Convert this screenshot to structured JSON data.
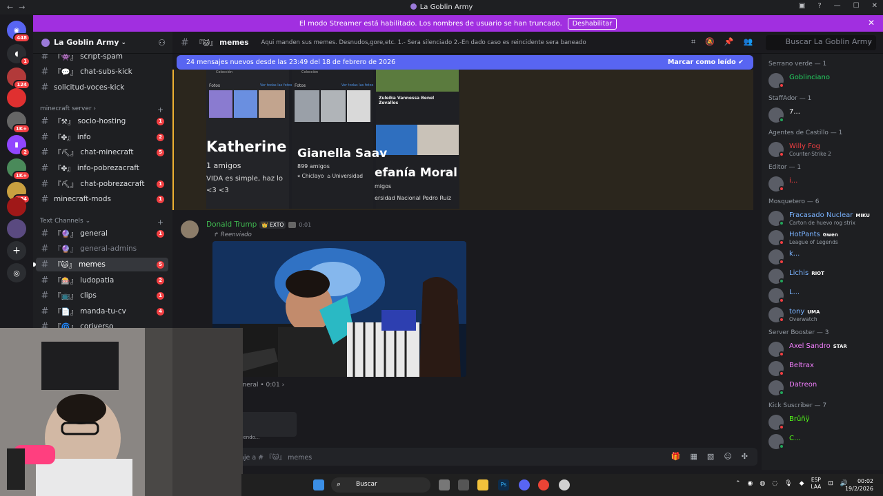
{
  "window": {
    "title": "La Goblin Army"
  },
  "banner": {
    "text": "El modo Streamer está habilitado. Los nombres de usuario se han truncado.",
    "button": "Deshabilitar"
  },
  "guilds": [
    {
      "badge": "448"
    },
    {
      "badge": "1"
    },
    {
      "badge": "124"
    },
    {
      "badge": ""
    },
    {
      "badge": "1K+"
    },
    {
      "badge": "2"
    },
    {
      "badge": "1K+"
    },
    {
      "badge": "104"
    },
    {
      "badge": ""
    },
    {
      "badge": ""
    }
  ],
  "server": {
    "name": "La Goblin Army"
  },
  "channels": {
    "top": [
      {
        "name": "script-spam",
        "prefix": "『👾』"
      },
      {
        "name": "chat-subs-kick",
        "prefix": "『💬』"
      },
      {
        "name": "solicitud-voces-kick",
        "prefix": ""
      }
    ],
    "cat_minecraft": "minecraft server",
    "minecraft": [
      {
        "name": "socio-hosting",
        "prefix": "『⚒』",
        "unread": "1"
      },
      {
        "name": "info",
        "prefix": "『✤』",
        "unread": "2"
      },
      {
        "name": "chat-minecraft",
        "prefix": "『⛏』",
        "unread": "5"
      },
      {
        "name": "info-pobrezacraft",
        "prefix": "『✤』",
        "unread": ""
      },
      {
        "name": "chat-pobrezacraft",
        "prefix": "『⛏』",
        "unread": "1"
      },
      {
        "name": "minecraft-mods",
        "prefix": "",
        "unread": "1"
      }
    ],
    "cat_text": "Text Channels",
    "text": [
      {
        "name": "general",
        "prefix": "『🔮』",
        "unread": "1"
      },
      {
        "name": "general-admins",
        "prefix": "『🔮』",
        "unread": ""
      },
      {
        "name": "memes",
        "prefix": "『🐱』",
        "unread": "5"
      },
      {
        "name": "ludopatia",
        "prefix": "『🎰』",
        "unread": "2"
      },
      {
        "name": "clips",
        "prefix": "『📺』",
        "unread": "1"
      },
      {
        "name": "manda-tu-cv",
        "prefix": "『📄』",
        "unread": "4"
      },
      {
        "name": "coriverso",
        "prefix": "『🌀』",
        "unread": ""
      }
    ]
  },
  "header": {
    "channel": "memes",
    "prefix": "『🐱』",
    "topic": "Aqui manden sus memes. Desnudos,gore,etc. 1.- Sera silenciado 2.-En dado caso es reincidente sera baneado",
    "search": "Buscar La Goblin Army"
  },
  "newbar": {
    "text": "24 mensajes nuevos desde las 23:49 del 18 de febrero de 2026",
    "mark": "Marcar como leído"
  },
  "shot": {
    "h1": "Fotos",
    "h2": "Ver todas las fotos",
    "h3": "Fotos",
    "h4": "Ver todas las fotos",
    "n1": "Katherine",
    "n1sub": "1 amigos",
    "n1sub2": "VIDA es simple, haz lo",
    "n1sub3": "<3 <3",
    "n2": "Gianella Saav",
    "n2sub": "899 amigos",
    "n2loc": "Chiclayo",
    "n2uni": "Universidad",
    "n3title": "Zuleika Vannessa Benel Zevallos",
    "n3": "efanía Moral",
    "n3sub": "migos",
    "n3uni": "ersidad Nacional Pedro Ruiz",
    "col1": "Colección",
    "col2": "Colección"
  },
  "message": {
    "author": "Donald Trump",
    "tag": "EXTO",
    "time": "0:01",
    "forwarded": "Reenviado",
    "source": "eneral • 0:01 ›",
    "typing": "biendo..."
  },
  "composer": {
    "placeholder": "aje a # 『🐱』 memes"
  },
  "members": {
    "groups": [
      {
        "title": "Serrano verde — 1",
        "items": [
          {
            "name": "Goblinciano",
            "color": "#23d160",
            "status": ""
          }
        ]
      },
      {
        "title": "StaffAdor — 1",
        "items": [
          {
            "name": "7...",
            "color": "#f2f3f5",
            "status": ""
          }
        ]
      },
      {
        "title": "Agentes de Castillo — 1",
        "items": [
          {
            "name": "Willy Fog",
            "color": "#f23f42",
            "status": "Counter-Strike 2"
          }
        ]
      },
      {
        "title": "Editor — 1",
        "items": [
          {
            "name": "i...",
            "color": "#f23f42",
            "status": ""
          }
        ]
      },
      {
        "title": "Mosquetero — 6",
        "items": [
          {
            "name": "Fracasado Nuclear",
            "color": "#7ab3ff",
            "status": "Carton de huevo rog strix",
            "badge": "MIKU"
          },
          {
            "name": "HotPants",
            "color": "#7ab3ff",
            "status": "League of Legends",
            "badge": "Gwen"
          },
          {
            "name": "k...",
            "color": "#7ab3ff",
            "status": ""
          },
          {
            "name": "Lichis",
            "color": "#7ab3ff",
            "status": "",
            "badge": "RIOT"
          },
          {
            "name": "L...",
            "color": "#7ab3ff",
            "status": ""
          },
          {
            "name": "tony",
            "color": "#7ab3ff",
            "status": "Overwatch",
            "badge": "UMA"
          }
        ]
      },
      {
        "title": "Server Booster — 3",
        "items": [
          {
            "name": "Axel Sandro",
            "color": "#f47fff",
            "status": "",
            "badge": "STAR"
          },
          {
            "name": "Beltrax",
            "color": "#f47fff",
            "status": ""
          },
          {
            "name": "Datreon",
            "color": "#f47fff",
            "status": ""
          }
        ]
      },
      {
        "title": "Kick Suscriber — 7",
        "items": [
          {
            "name": "Brûñÿ",
            "color": "#53fc18",
            "status": ""
          },
          {
            "name": "C...",
            "color": "#53fc18",
            "status": ""
          }
        ]
      }
    ]
  },
  "taskbar": {
    "search": "Buscar",
    "lang": "ESP",
    "lang2": "LAA",
    "time": "00:02",
    "date": "19/2/2026"
  },
  "colors": {
    "accent": "#5865f2",
    "banner": "#a12fe0",
    "online": "#23a55a",
    "dnd": "#f23f42"
  }
}
